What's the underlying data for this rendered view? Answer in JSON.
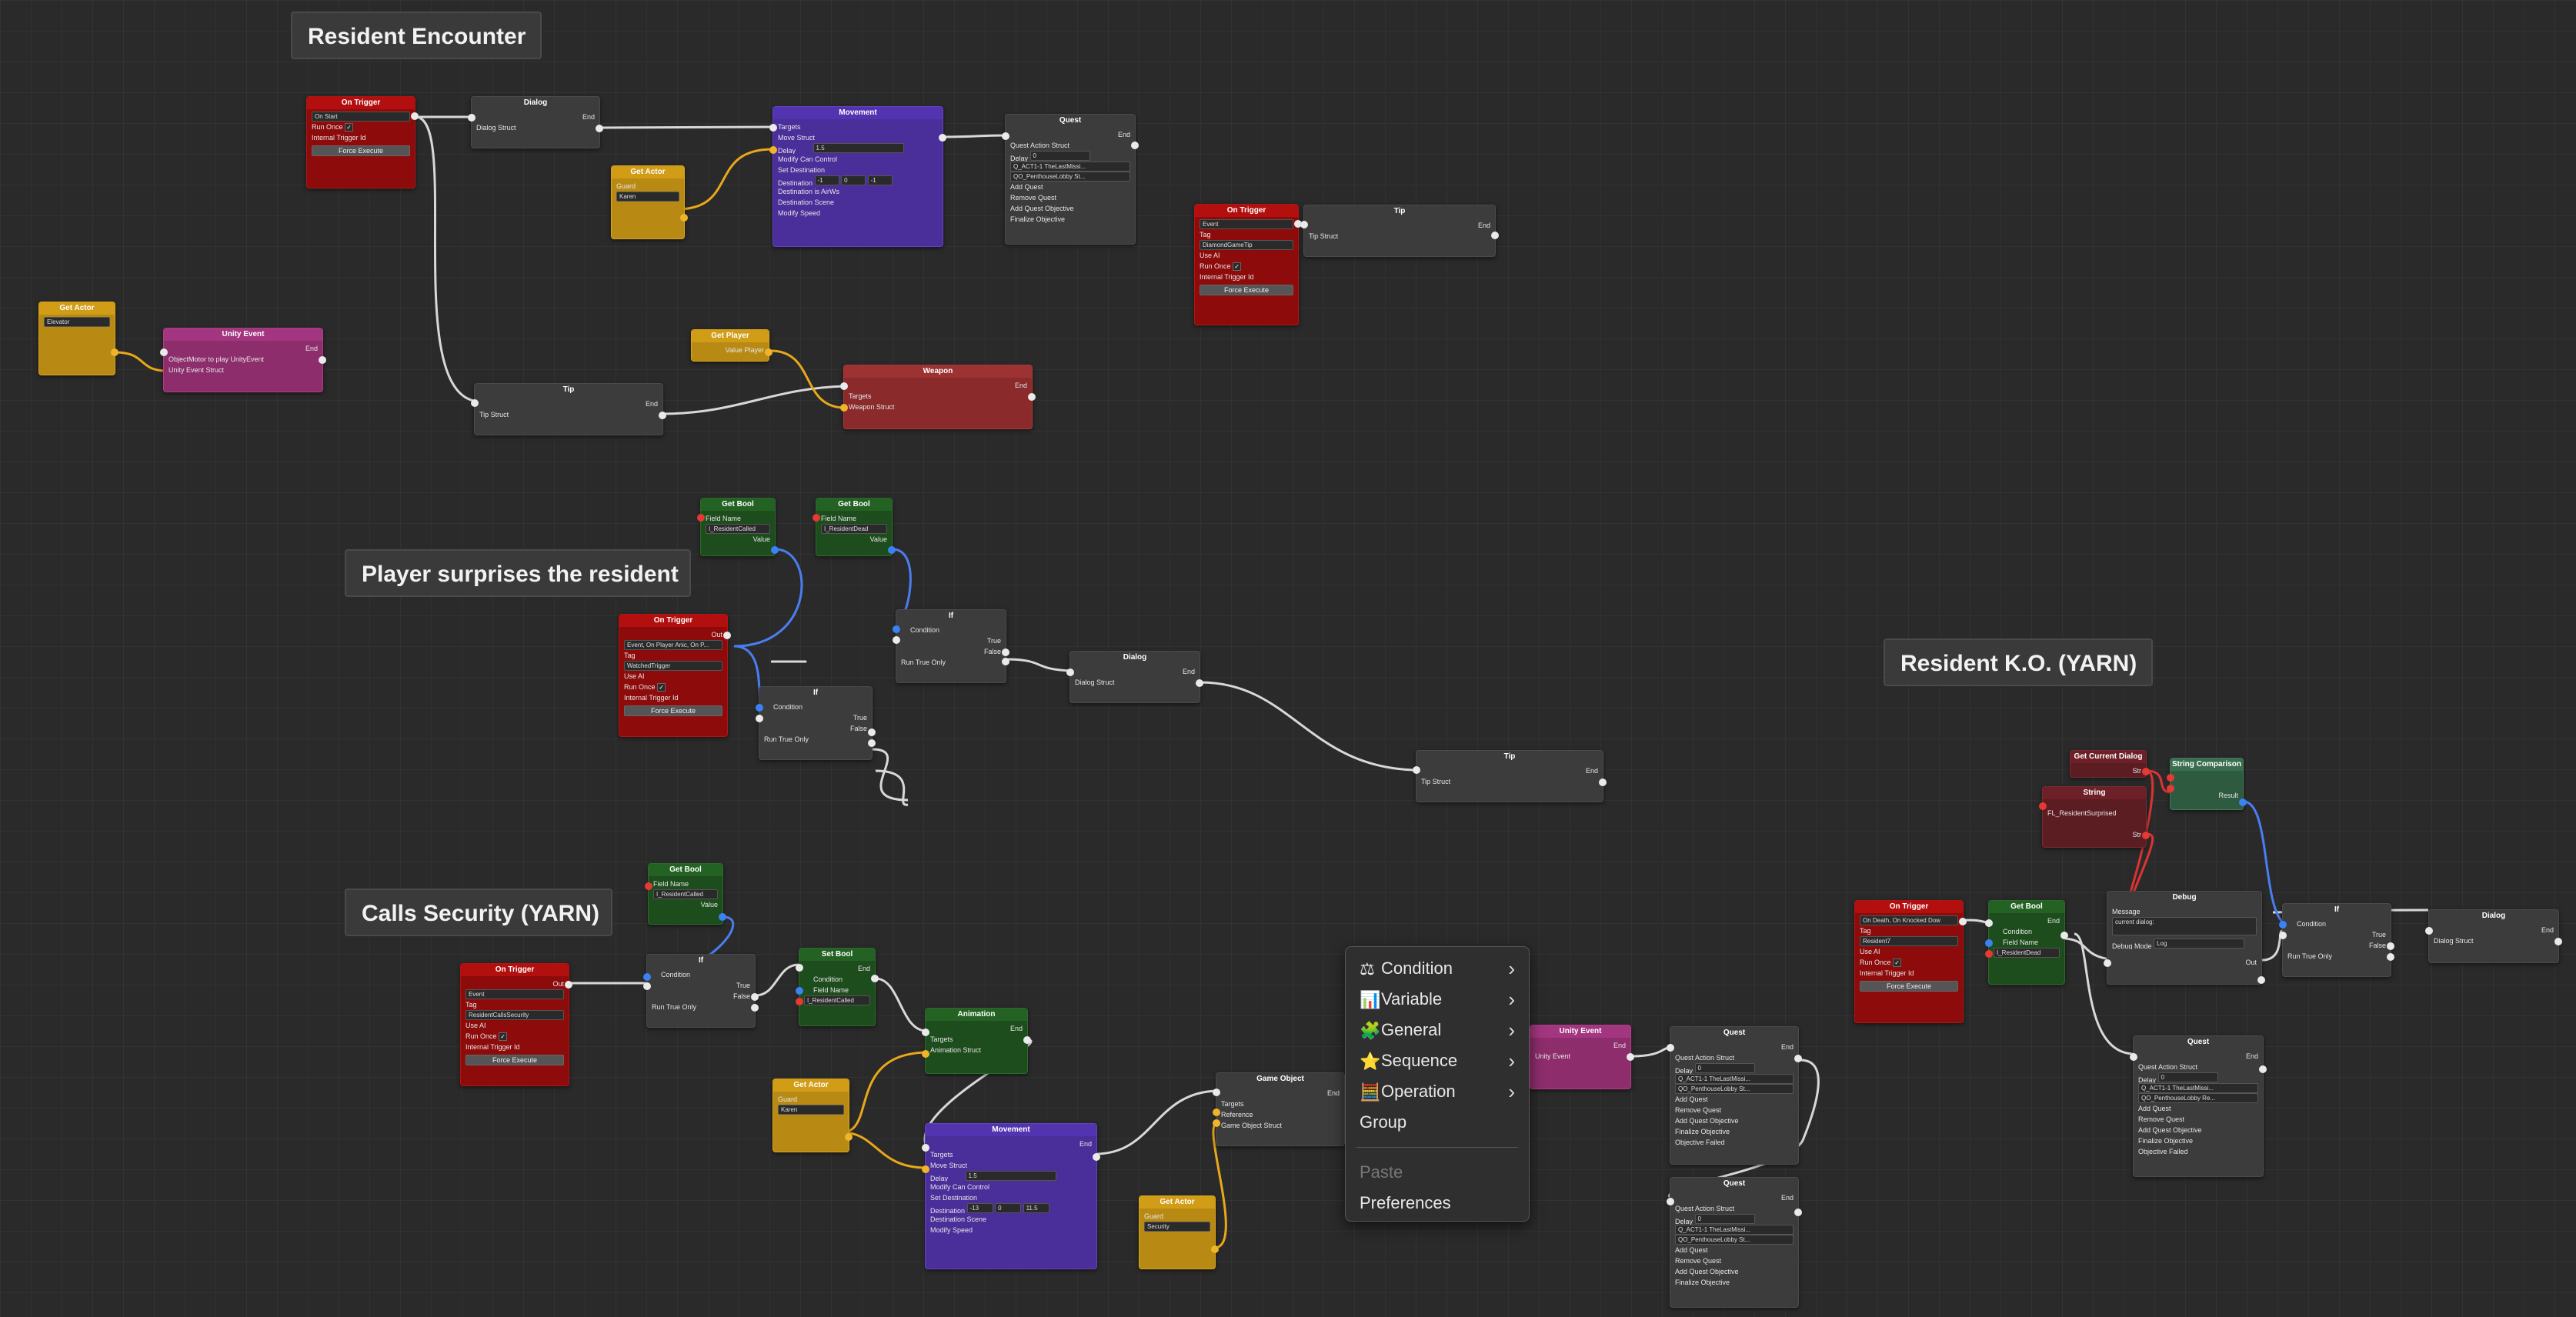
{
  "groups": {
    "resident_encounter": "Resident Encounter",
    "player_surprises": "Player surprises the resident",
    "calls_security": "Calls Security (YARN)",
    "resident_ko": "Resident K.O. (YARN)"
  },
  "labels": {
    "out": "Out",
    "in": "In",
    "end": "End",
    "targets": "Targets",
    "value": "Value",
    "condition": "Condition",
    "true": "True",
    "false": "False",
    "run_true_only": "Run True Only",
    "tag": "Tag",
    "use_ai": "Use AI",
    "run_once": "Run Once",
    "internal_trigger_id": "Internal Trigger Id",
    "force_execute": "Force Execute",
    "field_name": "Field Name",
    "guard": "Guard",
    "move_struct": "Move Struct",
    "quest_action_struct": "Quest Action Struct",
    "delay": "Delay",
    "message": "Message",
    "debug_mode": "Debug Mode",
    "result": "Result",
    "str": "Str",
    "reference": "Reference",
    "value_player": "Value Player"
  },
  "nodes": {
    "on_trigger_1": {
      "title": "On Trigger",
      "event": "On Start"
    },
    "dialog_1": {
      "title": "Dialog",
      "struct": "Dialog Struct"
    },
    "movement_1": {
      "title": "Movement",
      "rows": [
        "Move Struct",
        "Delay",
        "Modify Can Control",
        "Set Destination",
        "Destination",
        "Destination is AirWs",
        "Destination Scene",
        "Modify Speed"
      ],
      "delay_val": "1.5",
      "dest": [
        "-1",
        "0",
        "-1"
      ]
    },
    "quest_1": {
      "title": "Quest",
      "rows": [
        "Quest Action Struct",
        "Delay",
        "Q_ACT1-1 TheLastMissi...",
        "QO_PenthouseLobby St...",
        "Add Quest",
        "Remove Quest",
        "Add Quest Objective",
        "Finalize Objective"
      ],
      "delay_val": "0"
    },
    "get_actor_1": {
      "title": "Get Actor",
      "value": "Karen"
    },
    "on_trigger_2": {
      "title": "On Trigger",
      "event": "Event",
      "tag": "DiamondGameTip"
    },
    "tip_1": {
      "title": "Tip",
      "struct": "Tip Struct"
    },
    "get_actor_2": {
      "title": "Get Actor",
      "value": "Elevator"
    },
    "unity_event_1": {
      "title": "Unity Event",
      "rows": [
        "ObjectMotor to play UnityEvent",
        "Unity Event Struct"
      ]
    },
    "get_player_1": {
      "title": "Get Player"
    },
    "weapon_1": {
      "title": "Weapon",
      "struct": "Weapon Struct"
    },
    "tip_2": {
      "title": "Tip",
      "struct": "Tip Struct"
    },
    "get_bool_1": {
      "title": "Get Bool",
      "field": "I_ResidentCalled"
    },
    "get_bool_2": {
      "title": "Get Bool",
      "field": "I_ResidentDead"
    },
    "on_trigger_3": {
      "title": "On Trigger",
      "event": "Event, On Player Anic, On P...",
      "tag": "WatchedTrigger"
    },
    "if_1": {
      "title": "If"
    },
    "if_2": {
      "title": "If"
    },
    "dialog_2": {
      "title": "Dialog",
      "struct": "Dialog Struct"
    },
    "tip_3": {
      "title": "Tip",
      "struct": "Tip Struct"
    },
    "get_bool_3": {
      "title": "Get Bool",
      "field": "I_ResidentCalled"
    },
    "if_3": {
      "title": "If"
    },
    "set_bool_1": {
      "title": "Set Bool",
      "field": "I_ResidentCalled"
    },
    "on_trigger_4": {
      "title": "On Trigger",
      "event": "Event",
      "tag": "ResidentCallsSecurity"
    },
    "animation_1": {
      "title": "Animation",
      "struct": "Animation Struct"
    },
    "get_actor_3": {
      "title": "Get Actor",
      "value": "Karen"
    },
    "movement_2": {
      "title": "Movement",
      "rows": [
        "Move Struct",
        "Delay",
        "Modify Can Control",
        "Set Destination",
        "Destination",
        "Destination is AirWs",
        "Destination Scene",
        "Modify Speed"
      ],
      "delay_val": "1.5",
      "dest": [
        "-13",
        "0",
        "11.5"
      ]
    },
    "game_object_1": {
      "title": "Game Object",
      "struct": "Game Object Struct"
    },
    "get_actor_4": {
      "title": "Get Actor",
      "value": "Security"
    },
    "unity_event_2": {
      "title": "Unity Event",
      "struct": "Unity Event"
    },
    "quest_2": {
      "title": "Quest",
      "rows": [
        "Quest Action Struct",
        "Delay",
        "Q_ACT1-1 TheLastMissi...",
        "QO_PenthouseLobby St...",
        "Add Quest",
        "Remove Quest",
        "Add Quest Objective",
        "Finalize Objective",
        "Objective Failed"
      ],
      "delay_val": "0"
    },
    "quest_3": {
      "title": "Quest",
      "rows": [
        "Quest Action Struct",
        "Delay",
        "Q_ACT1-1 TheLastMissi...",
        "QO_PenthouseLobby St...",
        "Add Quest",
        "Remove Quest",
        "Add Quest Objective",
        "Finalize Objective"
      ],
      "delay_val": "0"
    },
    "get_current_dialog": {
      "title": "Get Current Dialog"
    },
    "string_1": {
      "title": "String",
      "value": "FL_ResidentSurprised"
    },
    "string_comparison": {
      "title": "String Comparison"
    },
    "on_trigger_5": {
      "title": "On Trigger",
      "event": "On Death, On Knocked Dow",
      "tag": "Resident7"
    },
    "get_bool_4": {
      "title": "Get Bool",
      "field": "I_ResidentDead"
    },
    "debug_1": {
      "title": "Debug",
      "message": "current dialog:",
      "mode": "Log"
    },
    "if_4": {
      "title": "If"
    },
    "dialog_3": {
      "title": "Dialog",
      "struct": "Dialog Struct"
    },
    "quest_4": {
      "title": "Quest",
      "rows": [
        "Quest Action Struct",
        "Delay",
        "Q_ACT1-1 TheLastMissi...",
        "QO_PenthouseLobby Re...",
        "Add Quest",
        "Remove Quest",
        "Add Quest Objective",
        "Finalize Objective",
        "Objective Failed"
      ],
      "delay_val": "0"
    }
  },
  "context_menu": {
    "items": [
      {
        "label": "Condition",
        "icon": "scale-icon",
        "glyph": "⚖",
        "submenu": true
      },
      {
        "label": "Variable",
        "icon": "bar-chart-icon",
        "glyph": "📊",
        "submenu": true
      },
      {
        "label": "General",
        "icon": "puzzle-icon",
        "glyph": "🧩",
        "submenu": true
      },
      {
        "label": "Sequence",
        "icon": "star-icon",
        "glyph": "⭐",
        "submenu": true
      },
      {
        "label": "Operation",
        "icon": "abacus-icon",
        "glyph": "🧮",
        "submenu": true
      },
      {
        "label": "Group",
        "icon": "",
        "glyph": "",
        "submenu": false
      }
    ],
    "paste": "Paste",
    "preferences": "Preferences"
  }
}
